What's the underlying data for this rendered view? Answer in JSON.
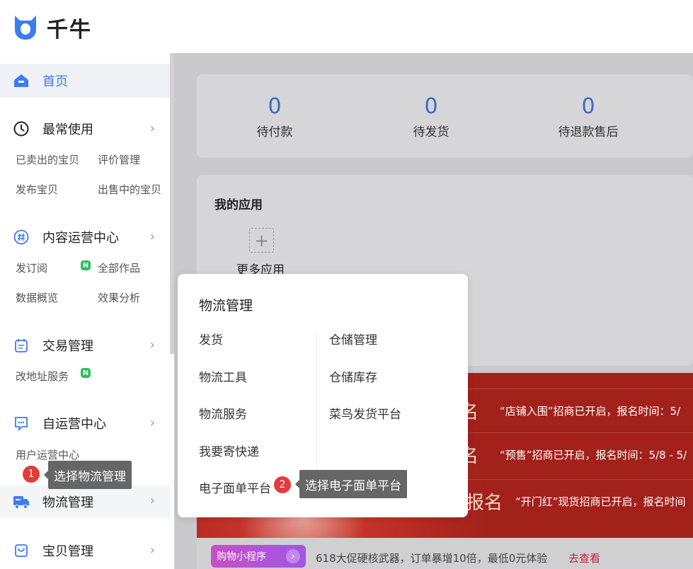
{
  "app": {
    "name": "千牛"
  },
  "sidebar": {
    "home": "首页",
    "frequent": {
      "label": "最常使用",
      "subs": [
        "已卖出的宝贝",
        "评价管理",
        "发布宝贝",
        "出售中的宝贝"
      ]
    },
    "content": {
      "label": "内容运营中心",
      "subs": [
        "发订阅",
        "全部作品",
        "数据概览",
        "效果分析"
      ]
    },
    "trade": {
      "label": "交易管理",
      "subs": [
        "改地址服务"
      ]
    },
    "self_ops": {
      "label": "自运营中心",
      "subs": [
        "用户运营中心"
      ]
    },
    "logistics": {
      "label": "物流管理"
    },
    "goods": {
      "label": "宝贝管理"
    },
    "new_badge": "N"
  },
  "stats": [
    {
      "value": "0",
      "label": "待付款"
    },
    {
      "value": "0",
      "label": "待发货"
    },
    {
      "value": "0",
      "label": "待退款售后"
    }
  ],
  "apps": {
    "title": "我的应用",
    "more": "更多应用",
    "plus": "+"
  },
  "promo": {
    "rows": [
      {
        "big": "名",
        "text": "“店铺入围”招商已开启，报名时间：5/"
      },
      {
        "big": "名",
        "text": "“预售”招商已开启，报名时间：5/8 - 5/"
      },
      {
        "big": "报名",
        "text": "“开门红”现货招商已开启，报名时间"
      }
    ]
  },
  "footer": {
    "mini": "购物小程序",
    "arrow": "›",
    "text": "618大促硬核武器，订单暴增10倍，最低0元体验",
    "link": "去查看"
  },
  "popup": {
    "title": "物流管理",
    "left": [
      "发货",
      "物流工具",
      "物流服务",
      "我要寄快递",
      "电子面单平台"
    ],
    "right": [
      "仓储管理",
      "仓储库存",
      "菜鸟发货平台"
    ]
  },
  "tips": [
    {
      "step": "1",
      "text": "选择物流管理"
    },
    {
      "step": "2",
      "text": "选择电子面单平台"
    }
  ],
  "colors": {
    "accent": "#3d7cf0",
    "step": "#e43b3b",
    "promo": "#b02a22"
  }
}
